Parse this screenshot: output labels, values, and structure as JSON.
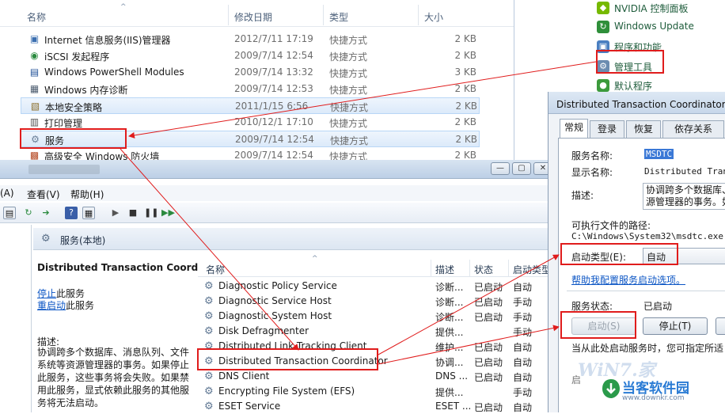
{
  "explorer": {
    "columns": {
      "name": "名称",
      "date": "修改日期",
      "type": "类型",
      "size": "大小"
    },
    "rows": [
      {
        "name": "Internet 信息服务(IIS)管理器",
        "date": "2012/7/11 17:19",
        "type": "快捷方式",
        "size": "2 KB",
        "icon": "iis-icon"
      },
      {
        "name": "iSCSI 发起程序",
        "date": "2009/7/14 12:54",
        "type": "快捷方式",
        "size": "2 KB",
        "icon": "iscsi-icon"
      },
      {
        "name": "Windows PowerShell Modules",
        "date": "2009/7/14 13:32",
        "type": "快捷方式",
        "size": "3 KB",
        "icon": "powershell-icon"
      },
      {
        "name": "Windows 内存诊断",
        "date": "2009/7/14 12:53",
        "type": "快捷方式",
        "size": "2 KB",
        "icon": "memory-diagnostic-icon"
      },
      {
        "name": "本地安全策略",
        "date": "2011/1/15 6:56",
        "type": "快捷方式",
        "size": "2 KB",
        "icon": "security-policy-icon"
      },
      {
        "name": "打印管理",
        "date": "2010/12/1 17:10",
        "type": "快捷方式",
        "size": "2 KB",
        "icon": "print-management-icon"
      },
      {
        "name": "服务",
        "date": "2009/7/14 12:54",
        "type": "快捷方式",
        "size": "2 KB",
        "icon": "services-icon"
      },
      {
        "name": "高级安全 Windows 防火墙",
        "date": "2009/7/14 12:54",
        "type": "快捷方式",
        "size": "2 KB",
        "icon": "firewall-icon"
      }
    ]
  },
  "control_panel": {
    "items": [
      {
        "label": "NVIDIA 控制面板",
        "icon": "nvidia-icon",
        "color": "#76b900"
      },
      {
        "label": "Windows Update",
        "icon": "windows-update-icon",
        "color": "#2f8f3a"
      },
      {
        "label": "程序和功能",
        "icon": "programs-icon",
        "color": "#4a7fc1"
      },
      {
        "label": "管理工具",
        "icon": "admin-tools-icon",
        "color": "#6b8cb0"
      },
      {
        "label": "默认程序",
        "icon": "default-programs-icon",
        "color": "#3c9a3c"
      }
    ]
  },
  "services": {
    "menu": {
      "action": "(A)",
      "view": "查看(V)",
      "help": "帮助(H)"
    },
    "pane_title": "服务(本地)",
    "selected": {
      "name": "Distributed Transaction Coordinator",
      "stop": "停止",
      "stop_rest": "此服务",
      "restart": "重启动",
      "restart_rest": "此服务",
      "desc_label": "描述:",
      "description": "协调跨多个数据库、消息队列、文件系统等资源管理器的事务。如果停止此服务，这些事务将会失败。如果禁用此服务，显式依赖此服务的其他服务将无法启动。"
    },
    "columns": {
      "name": "名称",
      "desc": "描述",
      "status": "状态",
      "startup": "启动类型"
    },
    "rows": [
      {
        "name": "Diagnostic Policy Service",
        "desc": "诊断...",
        "status": "已启动",
        "startup": "自动"
      },
      {
        "name": "Diagnostic Service Host",
        "desc": "诊断...",
        "status": "已启动",
        "startup": "手动"
      },
      {
        "name": "Diagnostic System Host",
        "desc": "诊断...",
        "status": "已启动",
        "startup": "手动"
      },
      {
        "name": "Disk Defragmenter",
        "desc": "提供...",
        "status": "",
        "startup": "手动"
      },
      {
        "name": "Distributed Link Tracking Client",
        "desc": "维护...",
        "status": "已启动",
        "startup": "自动"
      },
      {
        "name": "Distributed Transaction Coordinator",
        "desc": "协调...",
        "status": "已启动",
        "startup": "自动"
      },
      {
        "name": "DNS Client",
        "desc": "DNS ...",
        "status": "已启动",
        "startup": "自动"
      },
      {
        "name": "Encrypting File System (EFS)",
        "desc": "提供...",
        "status": "",
        "startup": "手动"
      },
      {
        "name": "ESET Service",
        "desc": "ESET ...",
        "status": "已启动",
        "startup": "自动"
      }
    ]
  },
  "dialog": {
    "title": "Distributed Transaction Coordinator 的",
    "tabs": [
      "常规",
      "登录",
      "恢复",
      "依存关系"
    ],
    "service_name_label": "服务名称:",
    "service_name": "MSDTC",
    "display_name_label": "显示名称:",
    "display_name": "Distributed Transa",
    "desc_label": "描述:",
    "desc_line1": "协调跨多个数据库、",
    "desc_line2": "源管理器的事务。如",
    "path_label": "可执行文件的路径:",
    "path": "C:\\Windows\\System32\\msdtc.exe",
    "startup_label": "启动类型(E):",
    "startup_value": "自动",
    "help_link": "帮助我配置服务启动选项。",
    "status_label": "服务状态:",
    "status_value": "已启动",
    "start_btn": "启动(S)",
    "stop_btn": "停止(T)",
    "footer_text": "当从此处启动服务时，您可指定所适",
    "footer_partial": "启"
  },
  "watermark": {
    "line1": "WiN7.家",
    "line2": "当客软件园",
    "line3": "www.downkr.com"
  }
}
